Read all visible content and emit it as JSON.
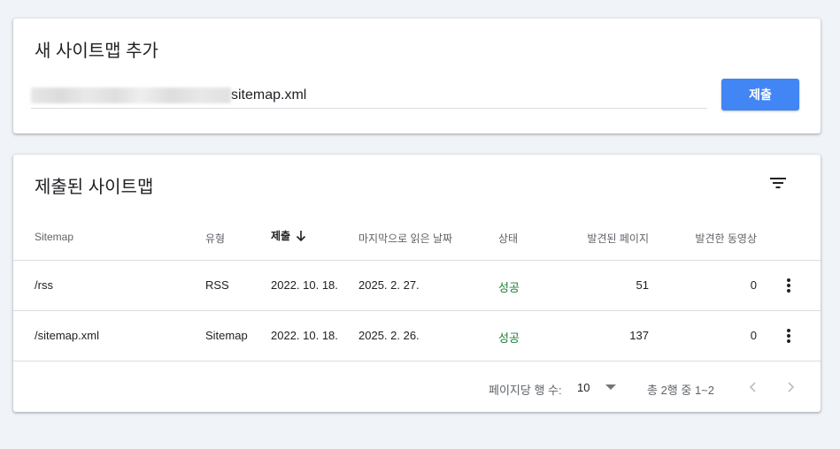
{
  "add_card": {
    "title": "새 사이트맵 추가",
    "input_value": "sitemap.xml",
    "submit_label": "제출"
  },
  "list_card": {
    "title": "제출된 사이트맵",
    "columns": {
      "sitemap": "Sitemap",
      "type": "유형",
      "submitted": "제출",
      "last_read": "마지막으로 읽은 날짜",
      "status": "상태",
      "pages": "발견된 페이지",
      "videos": "발견한 동영상"
    },
    "rows": [
      {
        "sitemap": "/rss",
        "type": "RSS",
        "submitted": "2022. 10. 18.",
        "last_read": "2025. 2. 27.",
        "status": "성공",
        "pages": "51",
        "videos": "0"
      },
      {
        "sitemap": "/sitemap.xml",
        "type": "Sitemap",
        "submitted": "2022. 10. 18.",
        "last_read": "2025. 2. 26.",
        "status": "성공",
        "pages": "137",
        "videos": "0"
      }
    ],
    "footer": {
      "rows_per_page_label": "페이지당 행 수:",
      "rows_per_page_value": "10",
      "range_label": "총 2행 중 1~2"
    }
  },
  "colors": {
    "accent": "#4285f4",
    "success": "#188038",
    "background": "#f0f3f8"
  }
}
